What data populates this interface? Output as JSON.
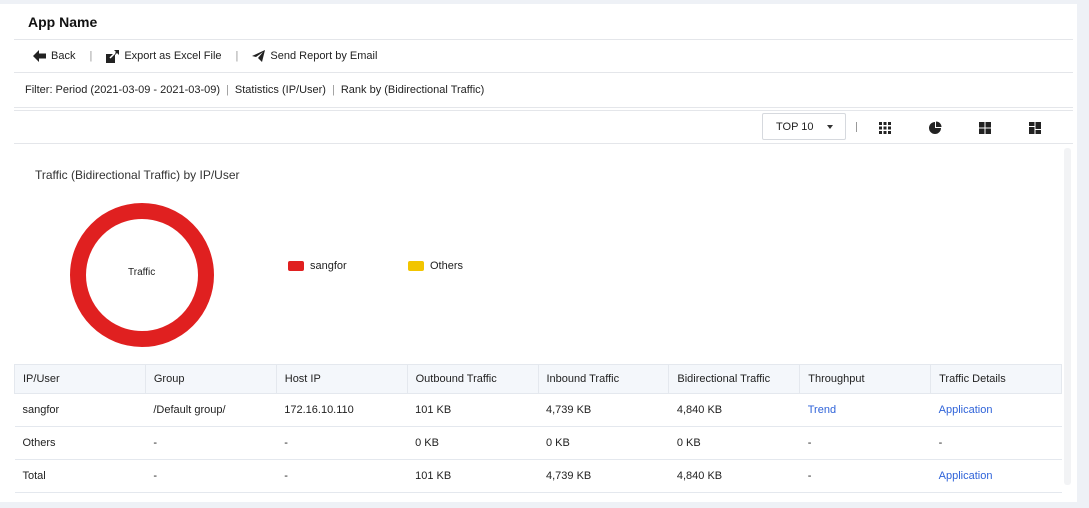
{
  "app": {
    "title": "App Name"
  },
  "toolbar": {
    "back_label": "Back",
    "export_label": "Export as Excel File",
    "email_label": "Send Report by Email",
    "separator": "|"
  },
  "filter": {
    "period": "Filter: Period (2021-03-09 - 2021-03-09)",
    "statistics": "Statistics (IP/User)",
    "rank": "Rank by (Bidirectional Traffic)",
    "separator": "|"
  },
  "controls": {
    "top_select_value": "TOP 10",
    "view_icons": [
      "grid-view-icon",
      "pie-chart-icon",
      "four-square-icon",
      "dashboard-icon"
    ]
  },
  "chart_data": {
    "type": "pie",
    "title": "Traffic (Bidirectional Traffic) by IP/User",
    "center_label": "Traffic",
    "donut": true,
    "categories": [
      "sangfor",
      "Others"
    ],
    "values": [
      4840,
      0
    ],
    "colors": [
      "#e02020",
      "#f2c500"
    ],
    "legend_position": "right"
  },
  "table": {
    "columns": [
      "IP/User",
      "Group",
      "Host IP",
      "Outbound Traffic",
      "Inbound Traffic",
      "Bidirectional Traffic",
      "Throughput",
      "Traffic Details"
    ],
    "rows": [
      {
        "ip_user": "sangfor",
        "group": "/Default group/",
        "host_ip": "172.16.10.110",
        "outbound": "101 KB",
        "inbound": "4,739 KB",
        "bidirectional": "4,840 KB",
        "throughput": "Trend",
        "details": "Application"
      },
      {
        "ip_user": "Others",
        "group": "-",
        "host_ip": "-",
        "outbound": "0 KB",
        "inbound": "0 KB",
        "bidirectional": "0 KB",
        "throughput": "-",
        "details": "-"
      },
      {
        "ip_user": "Total",
        "group": "-",
        "host_ip": "-",
        "outbound": "101 KB",
        "inbound": "4,739 KB",
        "bidirectional": "4,840 KB",
        "throughput": "-",
        "details": "Application"
      }
    ]
  },
  "colors": {
    "link": "#2f63d9",
    "accent_red": "#e02020",
    "accent_yellow": "#f2c500"
  }
}
